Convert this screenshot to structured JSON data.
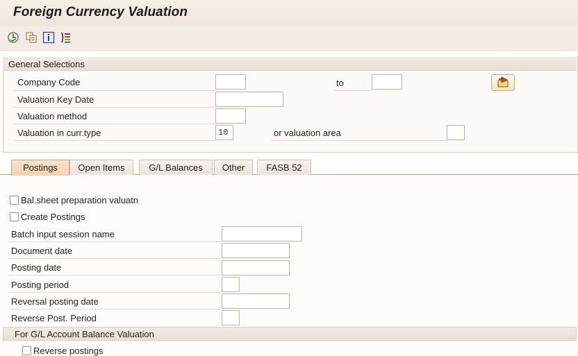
{
  "window": {
    "title": "Foreign Currency Valuation"
  },
  "toolbar": {
    "icons": [
      "execute-icon",
      "copy-variant-icon",
      "info-icon",
      "program-doc-icon"
    ]
  },
  "general_selections": {
    "title": "General Selections",
    "company_code": {
      "label": "Company Code",
      "value_from": "",
      "to_label": "to",
      "value_to": ""
    },
    "valuation_key_date": {
      "label": "Valuation Key Date",
      "value": ""
    },
    "valuation_method": {
      "label": "Valuation method",
      "value": ""
    },
    "valuation_curr_type": {
      "label": "Valuation in curr.type",
      "value": "10",
      "or_label": "or valuation area",
      "area_value": ""
    }
  },
  "tabs": [
    {
      "label": "Postings",
      "active": true
    },
    {
      "label": "Open Items",
      "active": false
    },
    {
      "label": "G/L Balances",
      "active": false
    },
    {
      "label": "Other",
      "active": false
    },
    {
      "label": "FASB 52",
      "active": false
    }
  ],
  "postings": {
    "bal_sheet": {
      "label": "Bal.sheet preparation valuatn",
      "checked": false
    },
    "create_postings": {
      "label": "Create Postings",
      "checked": false
    },
    "batch_session": {
      "label": "Batch input session name",
      "value": ""
    },
    "document_date": {
      "label": "Document date",
      "value": ""
    },
    "posting_date": {
      "label": "Posting date",
      "value": ""
    },
    "posting_period": {
      "label": "Posting period",
      "value": ""
    },
    "reversal_posting_date": {
      "label": "Reversal posting date",
      "value": ""
    },
    "reverse_post_period": {
      "label": "Reverse Post. Period",
      "value": ""
    },
    "gl_group": {
      "title": "For G/L Account Balance Valuation"
    },
    "reverse_postings": {
      "label": "Reverse postings",
      "checked": false
    }
  },
  "colors": {
    "active_tab": "#f3d2b2",
    "tab_border": "#c9a27e",
    "header_bg": "#efe6dc"
  }
}
